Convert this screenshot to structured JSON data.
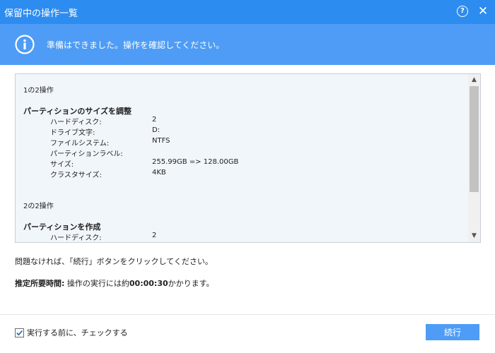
{
  "window": {
    "title": "保留中の操作一覧",
    "help_icon": "question-circle-icon",
    "close_icon": "close-icon",
    "close_glyph": "✕",
    "help_glyph": "?"
  },
  "banner": {
    "icon": "info-icon",
    "message": "準備はできました。操作を確認してください。"
  },
  "operations": {
    "op1": {
      "counter": "1の2操作",
      "title": "パーティションのサイズを調整",
      "fields": [
        {
          "label": "ハードディスク:",
          "value": "2"
        },
        {
          "label": "ドライブ文字:",
          "value": "D:"
        },
        {
          "label": "ファイルシステム:",
          "value": "NTFS"
        },
        {
          "label": "パーティションラベル:",
          "value": ""
        },
        {
          "label": "サイズ:",
          "value": "255.99GB => 128.00GB"
        },
        {
          "label": "クラスタサイズ:",
          "value": "4KB"
        }
      ]
    },
    "op2": {
      "counter": "2の2操作",
      "title": "パーティションを作成",
      "fields": [
        {
          "label": "ハードディスク:",
          "value": "2"
        }
      ]
    }
  },
  "note": "問題なければ、「続行」ボタンをクリックしてください。",
  "estimate": {
    "label": "推定所要時間:",
    "prefix": " 操作の実行には約",
    "duration": "00:00:30",
    "suffix": "かかります。"
  },
  "footer": {
    "checkbox_label": "実行する前に、チェックする",
    "checkbox_checked": true,
    "continue_label": "続行"
  },
  "colors": {
    "titlebar": "#2d8cf0",
    "banner": "#4e9cf5",
    "panel_bg": "#f1f6fb",
    "button": "#4e9cf5",
    "checkmark": "#2b6cb0"
  }
}
